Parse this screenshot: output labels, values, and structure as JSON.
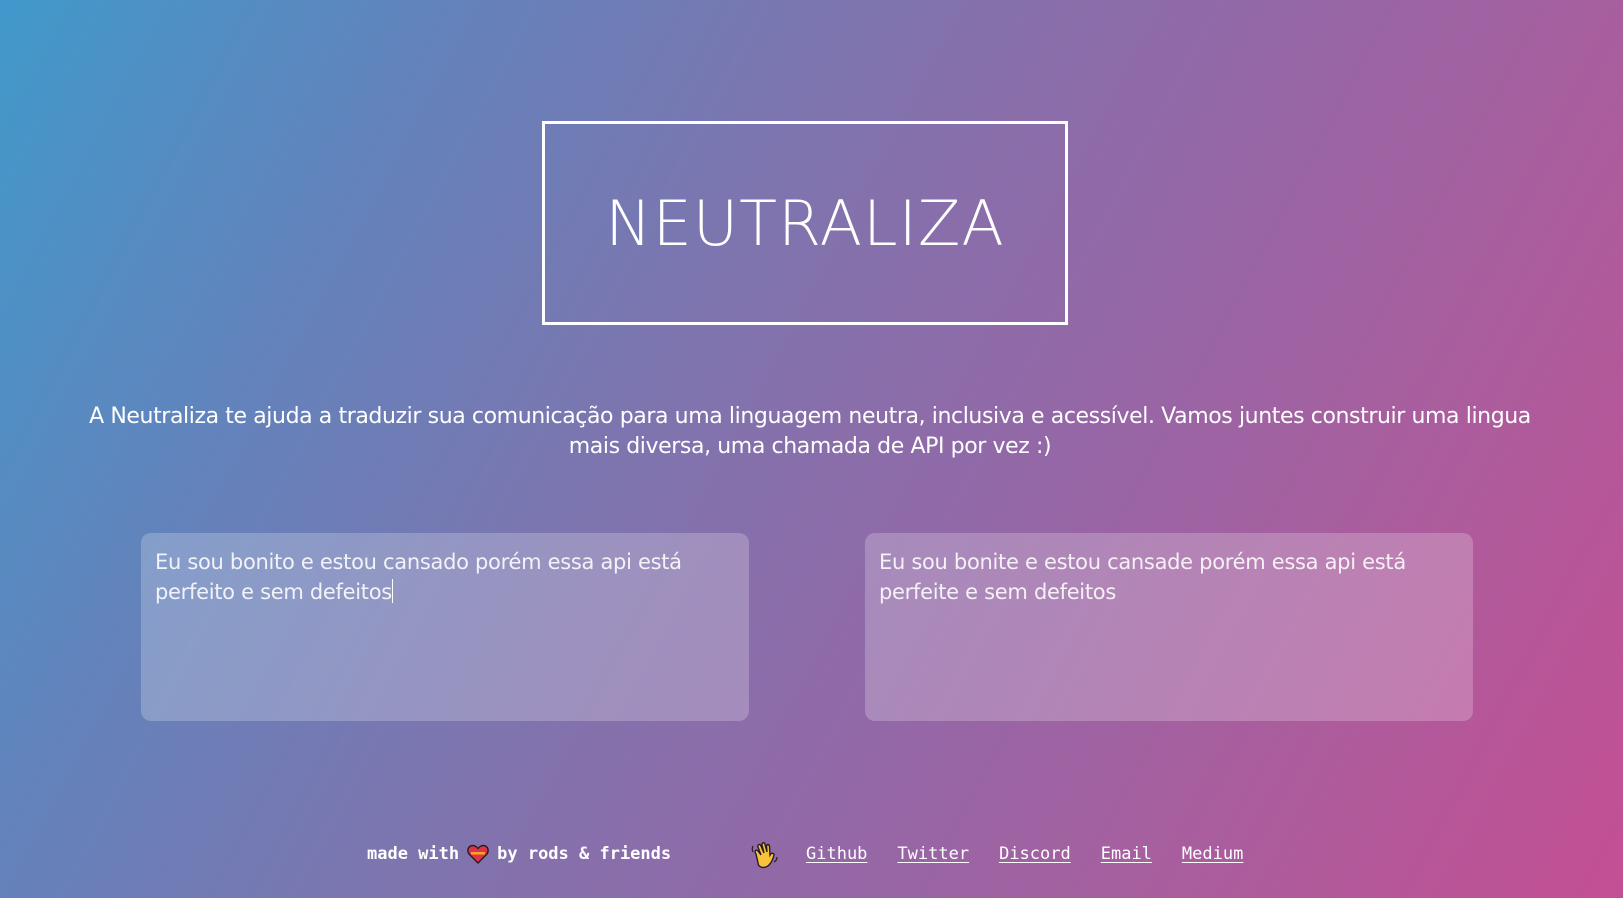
{
  "header": {
    "title": "NEUTRALIZA"
  },
  "tagline": "A Neutraliza te ajuda a traduzir sua comunicação para uma linguagem neutra, inclusiva e acessível. Vamos juntes construir uma lingua mais diversa, uma chamada de API por vez :)",
  "translator": {
    "input_text": "Eu sou bonito e estou cansado porém essa api está perfeito e sem defeitos",
    "output_text": "Eu sou bonite e estou cansade porém essa api está perfeite e sem defeitos"
  },
  "footer": {
    "made_with": "made with",
    "by": "by rods & friends",
    "links": [
      {
        "label": "Github"
      },
      {
        "label": "Twitter"
      },
      {
        "label": "Discord"
      },
      {
        "label": "Email"
      },
      {
        "label": "Medium"
      }
    ],
    "icons": {
      "heart": "heart-icon",
      "wave": "waving-hand-icon"
    }
  }
}
